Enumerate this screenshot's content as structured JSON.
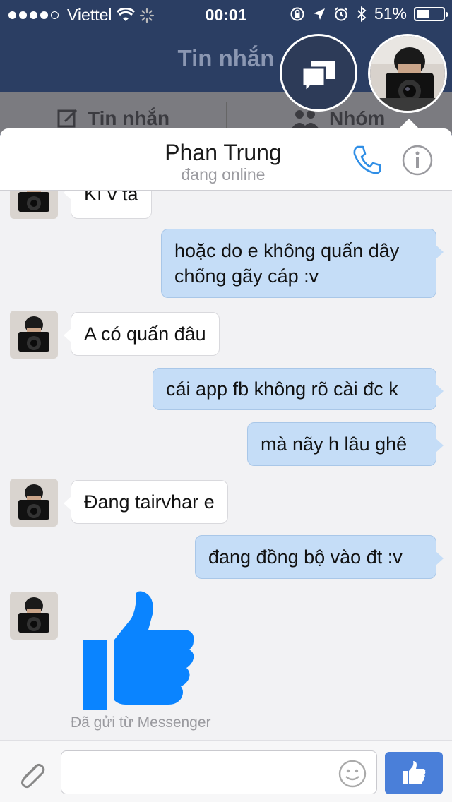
{
  "status_bar": {
    "carrier": "Viettel",
    "time": "00:01",
    "battery": "51%",
    "battery_level": 0.51
  },
  "nav": {
    "title": "Tin nhắn"
  },
  "segments": [
    {
      "label": "Tin nhắn"
    },
    {
      "label": "Nhóm"
    }
  ],
  "conversation": {
    "contact_name": "Phan Trung",
    "contact_status": "đang online"
  },
  "messages": [
    {
      "dir": "in",
      "text": "Kí v ta"
    },
    {
      "dir": "out",
      "line1": "hoặc do e không quấn dây",
      "line2": "chống gãy cáp :v"
    },
    {
      "dir": "in",
      "text": "A có quấn đâu"
    },
    {
      "dir": "out",
      "text": "cái app fb không rõ cài đc k"
    },
    {
      "dir": "out",
      "text": "mà nãy h lâu ghê"
    },
    {
      "dir": "in",
      "text": "Đang tairvhar e"
    },
    {
      "dir": "out",
      "text": "đang đồng bộ vào đt :v"
    },
    {
      "dir": "in",
      "type": "like-sticker",
      "caption": "Đã gửi từ Messenger"
    }
  ],
  "composer": {
    "value": "",
    "placeholder": ""
  },
  "colors": {
    "nav_bg": "#2b3e63",
    "outgoing_bubble": "#c5ddf7",
    "incoming_bubble": "#ffffff",
    "like_blue": "#0a84ff",
    "send_button": "#4a7fd9"
  },
  "icons": [
    "signal-dots-icon",
    "wifi-icon",
    "activity-spinner-icon",
    "rotation-lock-icon",
    "location-icon",
    "alarm-icon",
    "bluetooth-icon",
    "battery-icon",
    "chat-heads-icon",
    "compose-icon",
    "group-icon",
    "phone-icon",
    "info-icon",
    "paperclip-icon",
    "emoji-icon",
    "thumbs-up-icon"
  ]
}
